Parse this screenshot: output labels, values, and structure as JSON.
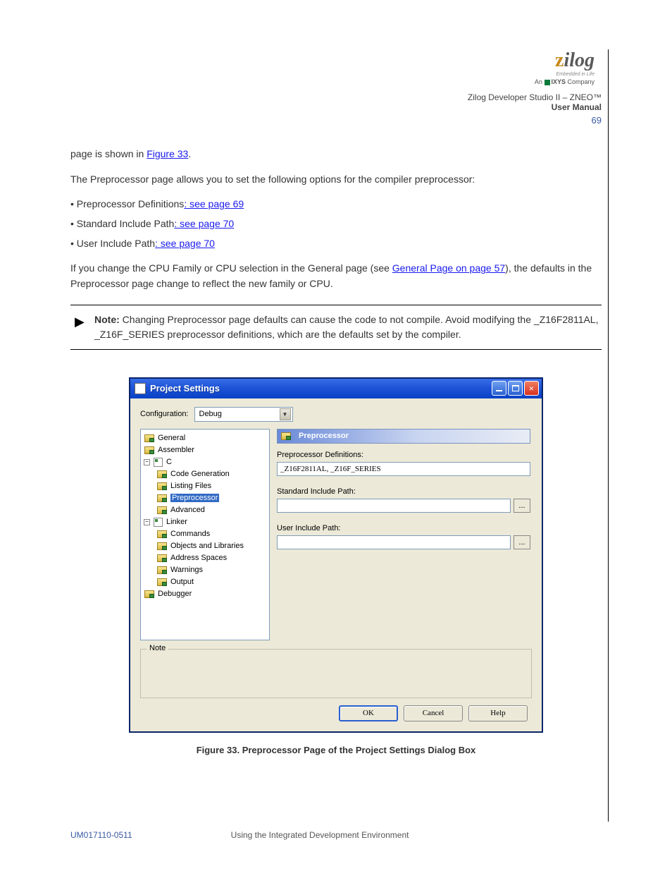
{
  "logo": {
    "brand_z": "z",
    "brand_rest": "ilog",
    "tagline": "Embedded in Life",
    "company_prefix": "An",
    "company_name": "IXYS",
    "company_suffix": "Company"
  },
  "doc_header": {
    "line1": "Zilog Developer Studio II – ZNEO™",
    "line2": "User Manual",
    "page": "69"
  },
  "para1_pre": "page is shown in ",
  "para1_link": "Figure 33",
  "para1_post": ".",
  "para2": "The Preprocessor page allows you to set the following options for the compiler preprocessor:",
  "bul1_label": "Preprocessor Definitions",
  "bul1_link": ": see page 69",
  "bul2_label": "Standard Include Path",
  "bul2_link": ": see page 70",
  "bul3_label": "User Include Path",
  "bul3_link": ": see page 70",
  "para3_a": "If you change the CPU Family or CPU selection in the General page (see ",
  "para3_link1": "General Page on page 57",
  "para3_b": "), the defaults in the Preprocessor page change to reflect the new family or CPU.",
  "note": {
    "label": "Note:",
    "text_a": "Changing Preprocessor page defaults can cause the code to not compile. Avoid modifying the ",
    "mono": "_Z16F2811AL, _Z16F_SERIES",
    "text_b": " preprocessor definitions, which are the defaults set by the compiler."
  },
  "dialog": {
    "title": "Project Settings",
    "config_label": "Configuration:",
    "config_value": "Debug",
    "tree": {
      "general": "General",
      "assembler": "Assembler",
      "c": "C",
      "codegen": "Code Generation",
      "listing": "Listing Files",
      "preproc": "Preprocessor",
      "advanced": "Advanced",
      "linker": "Linker",
      "commands": "Commands",
      "objects": "Objects and Libraries",
      "address": "Address Spaces",
      "warnings": "Warnings",
      "output": "Output",
      "debugger": "Debugger"
    },
    "panel": {
      "header": "Preprocessor",
      "defs_label": "Preprocessor Definitions:",
      "defs_value": "_Z16F2811AL, _Z16F_SERIES",
      "std_label": "Standard Include Path:",
      "std_value": "",
      "user_label": "User Include Path:",
      "user_value": "",
      "browse": "..."
    },
    "note_frame": "Note",
    "ok": "OK",
    "cancel": "Cancel",
    "help": "Help",
    "minus": "−",
    "close": "×"
  },
  "caption": "Figure 33. Preprocessor Page of the Project Settings Dialog Box",
  "footer": {
    "doc": "UM017110-0511",
    "section": "Using the Integrated Development Environment"
  }
}
